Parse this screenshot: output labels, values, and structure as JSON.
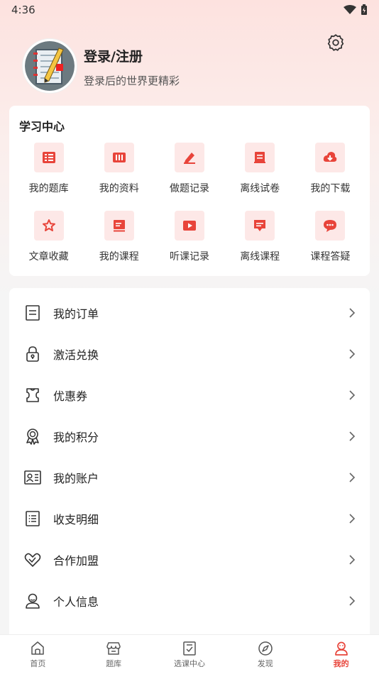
{
  "status_bar": {
    "time": "4:36"
  },
  "profile": {
    "login_label": "登录/注册",
    "subtitle": "登录后的世界更精彩"
  },
  "study_center": {
    "title": "学习中心",
    "items": [
      {
        "label": "我的题库",
        "icon": "question-bank-icon"
      },
      {
        "label": "我的资料",
        "icon": "materials-icon"
      },
      {
        "label": "做题记录",
        "icon": "practice-record-icon"
      },
      {
        "label": "离线试卷",
        "icon": "offline-paper-icon"
      },
      {
        "label": "我的下载",
        "icon": "download-icon"
      },
      {
        "label": "文章收藏",
        "icon": "star-icon"
      },
      {
        "label": "我的课程",
        "icon": "course-icon"
      },
      {
        "label": "听课记录",
        "icon": "play-icon"
      },
      {
        "label": "离线课程",
        "icon": "offline-course-icon"
      },
      {
        "label": "课程答疑",
        "icon": "chat-icon"
      }
    ]
  },
  "menu": {
    "items": [
      {
        "label": "我的订单",
        "icon": "order-icon"
      },
      {
        "label": "激活兑换",
        "icon": "lock-icon"
      },
      {
        "label": "优惠券",
        "icon": "coupon-icon"
      },
      {
        "label": "我的积分",
        "icon": "medal-icon"
      },
      {
        "label": "我的账户",
        "icon": "account-card-icon"
      },
      {
        "label": "收支明细",
        "icon": "list-icon"
      },
      {
        "label": "合作加盟",
        "icon": "handshake-icon"
      },
      {
        "label": "个人信息",
        "icon": "person-icon"
      }
    ]
  },
  "tabbar": {
    "tabs": [
      {
        "label": "首页",
        "icon": "home-icon"
      },
      {
        "label": "题库",
        "icon": "store-icon"
      },
      {
        "label": "选课中心",
        "icon": "checklist-icon"
      },
      {
        "label": "发现",
        "icon": "compass-icon"
      },
      {
        "label": "我的",
        "icon": "user-icon"
      }
    ],
    "active_index": 4
  },
  "colors": {
    "accent": "#e8443a",
    "icon_bg": "#fde8e7"
  }
}
